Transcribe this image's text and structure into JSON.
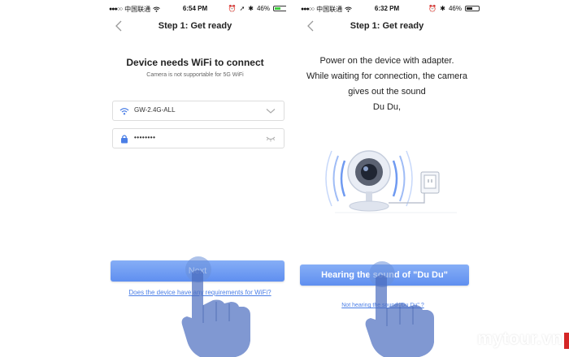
{
  "left_screen": {
    "status": {
      "carrier": "中国联通",
      "time": "6:54 PM",
      "battery": "46%"
    },
    "nav": {
      "title": "Step 1: Get ready"
    },
    "heading": "Device needs WiFi to connect",
    "subheading": "Camera is not supportable for 5G WiFi",
    "wifi_field": {
      "value": "GW-2.4G-ALL"
    },
    "password_field": {
      "value": "••••••••"
    },
    "next_label": "Next",
    "wifi_requirements_link": "Does the device have any requirements for WiFi?"
  },
  "right_screen": {
    "status": {
      "carrier": "中国联通",
      "time": "6:32 PM",
      "battery": "46%"
    },
    "nav": {
      "title": "Step 1: Get ready"
    },
    "instructions": [
      "Power on the device with adapter.",
      "While waiting for connection, the camera",
      "gives out the sound",
      "Du Du,"
    ],
    "hearing_button": "Hearing the sound of \"Du Du\"",
    "not_hearing_link": "Not hearing the sound \"Du Du\" ?"
  },
  "watermark": "mytour.vn",
  "colors": {
    "accent_blue": "#5f8ff0",
    "link_blue": "#4a7ee6",
    "battery_green": "#3ecb3e"
  },
  "icons": [
    "signal-dots-icon",
    "wifi-icon",
    "lock-icon",
    "chevron-down-icon",
    "eye-closed-icon",
    "back-chevron-icon",
    "alarm-icon",
    "location-icon",
    "bluetooth-icon",
    "battery-icon",
    "camera-icon",
    "power-outlet-icon",
    "hand-pointer-icon"
  ]
}
